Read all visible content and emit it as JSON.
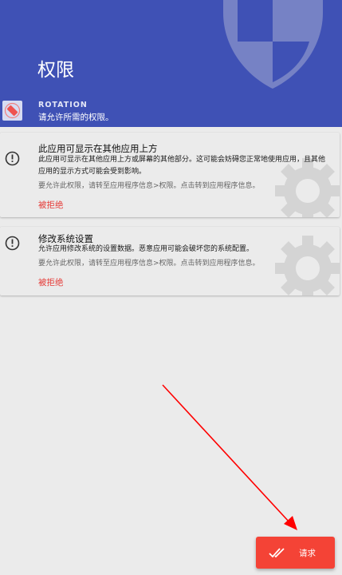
{
  "header": {
    "title": "权限",
    "app_name": "ROTATION",
    "app_description": "请允许所需的权限。",
    "color": "#3f51b5"
  },
  "permissions": [
    {
      "title": "此应用可显示在其他应用上方",
      "description": "此应用可显示在其他应用上方或屏幕的其他部分。这可能会妨碍您正常地使用应用，且其他应用的显示方式可能会受到影响。",
      "hint": "要允许此权限，请转至应用程序信息>权限。点击转到应用程序信息。",
      "status": "被拒绝",
      "icon": "alert-circle-icon"
    },
    {
      "title": "修改系统设置",
      "description": "允许应用修改系统的设置数据。恶意应用可能会破坏您的系统配置。",
      "hint": "要允许此权限，请转至应用程序信息>权限。点击转到应用程序信息。",
      "status": "被拒绝",
      "icon": "alert-circle-icon"
    }
  ],
  "request_button": {
    "label": "请求",
    "icon": "double-check-icon",
    "color": "#f44336"
  },
  "colors": {
    "background": "#ebebeb",
    "denied": "#e53935",
    "annotation_arrow": "#ff0000"
  }
}
